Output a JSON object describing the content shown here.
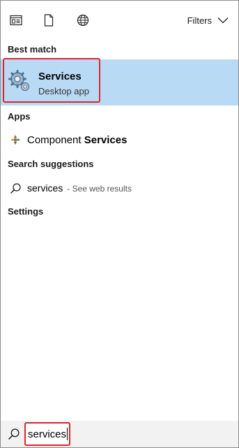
{
  "filterbar": {
    "filters_label": "Filters",
    "icons": [
      "documents-icon",
      "file-icon",
      "web-icon"
    ]
  },
  "best_match": {
    "section_title": "Best match",
    "title": "Services",
    "subtitle": "Desktop app"
  },
  "apps": {
    "section_title": "Apps",
    "items": [
      {
        "prefix": "Component ",
        "bold": "Services"
      }
    ]
  },
  "search_suggestions": {
    "section_title": "Search suggestions",
    "items": [
      {
        "query": "services",
        "hint": "- See web results"
      }
    ]
  },
  "settings": {
    "section_title": "Settings"
  },
  "searchbox": {
    "value": "services"
  },
  "colors": {
    "selection_bg": "#b9daf4",
    "highlight_border": "#e1242a",
    "searchbar_bg": "#f2f2f2"
  }
}
